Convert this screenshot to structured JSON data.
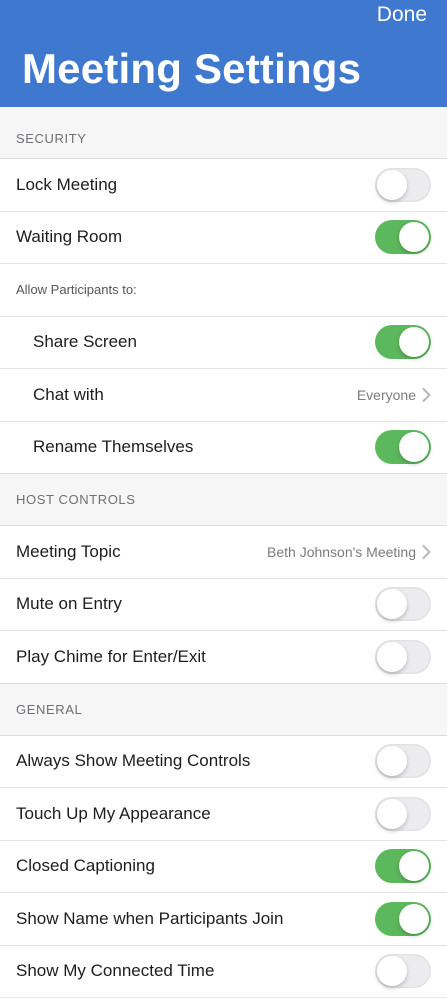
{
  "header": {
    "done_label": "Done",
    "title": "Meeting Settings"
  },
  "sections": {
    "security": {
      "title": "SECURITY",
      "lock_meeting": {
        "label": "Lock Meeting",
        "on": false
      },
      "waiting_room": {
        "label": "Waiting Room",
        "on": true
      },
      "allow_label": "Allow Participants to:",
      "share_screen": {
        "label": "Share Screen",
        "on": true
      },
      "chat_with": {
        "label": "Chat with",
        "value": "Everyone"
      },
      "rename": {
        "label": "Rename Themselves",
        "on": true
      }
    },
    "host_controls": {
      "title": "HOST CONTROLS",
      "meeting_topic": {
        "label": "Meeting Topic",
        "value": "Beth Johnson's Meeting"
      },
      "mute_on_entry": {
        "label": "Mute on Entry",
        "on": false
      },
      "play_chime": {
        "label": "Play Chime for Enter/Exit",
        "on": false
      }
    },
    "general": {
      "title": "GENERAL",
      "always_show_controls": {
        "label": "Always Show Meeting Controls",
        "on": false
      },
      "touch_up": {
        "label": "Touch Up My Appearance",
        "on": false
      },
      "closed_captioning": {
        "label": "Closed Captioning",
        "on": true
      },
      "show_name": {
        "label": "Show Name when Participants Join",
        "on": true
      },
      "connected_time": {
        "label": "Show My Connected Time",
        "on": false
      }
    }
  },
  "colors": {
    "header_bg": "#3e78cf",
    "toggle_on": "#5cb85c",
    "toggle_off": "#ececef"
  },
  "icons": {
    "chevron": "chevron-right-icon"
  }
}
